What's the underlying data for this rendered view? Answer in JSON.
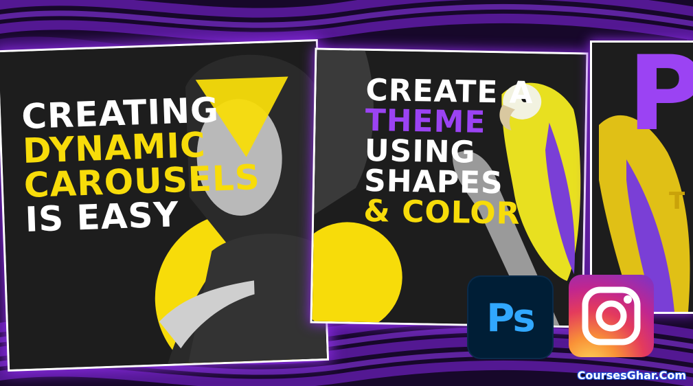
{
  "card1": {
    "lines": [
      "CREATING",
      "DYNAMIC",
      "CAROUSELS",
      "IS EASY"
    ]
  },
  "card2": {
    "lines": [
      "CREATE A",
      "THEME",
      "USING",
      "SHAPES",
      "& COLOR"
    ]
  },
  "card3": {
    "big_letter": "P",
    "small_letter": "T"
  },
  "badges": {
    "photoshop": "Ps"
  },
  "watermark": "CoursesGhar.Com",
  "colors": {
    "accent_yellow": "#f7dc0a",
    "accent_purple": "#9b43f3",
    "ps_blue": "#31a8ff",
    "ps_bg": "#001e36"
  }
}
